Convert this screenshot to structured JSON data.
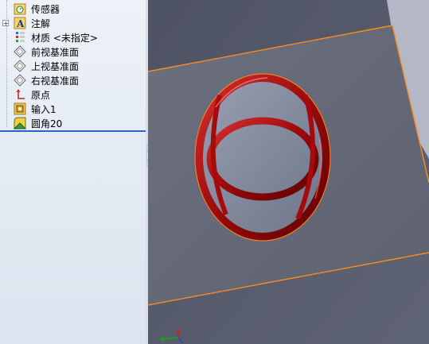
{
  "feature_tree": {
    "items": [
      {
        "label": "传感器",
        "icon": "sensor-folder-icon"
      },
      {
        "label": "注解",
        "icon": "annotation-folder-icon",
        "expandable": true
      },
      {
        "label": "材质 <未指定>",
        "icon": "material-icon"
      },
      {
        "label": "前视基准面",
        "icon": "plane-icon"
      },
      {
        "label": "上视基准面",
        "icon": "plane-icon"
      },
      {
        "label": "右视基准面",
        "icon": "plane-icon"
      },
      {
        "label": "原点",
        "icon": "origin-icon"
      },
      {
        "label": "输入1",
        "icon": "imported-body-icon"
      },
      {
        "label": "圆角20",
        "icon": "fillet-icon"
      }
    ]
  },
  "colors": {
    "viewport_bg": "#5b6070",
    "face": "#6a6e7c",
    "edge_highlight": "#ff8a1e",
    "fillet_red": "#a40b0b"
  }
}
